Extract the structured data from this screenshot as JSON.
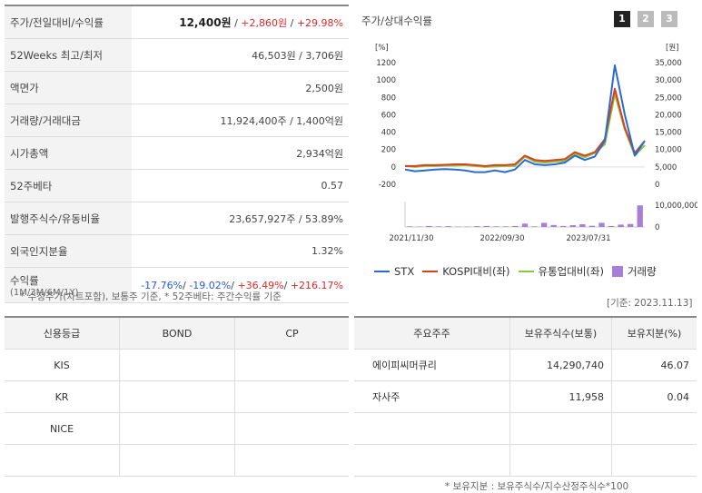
{
  "info": {
    "price_label": "주가/전일대비/수익률",
    "price": "12,400원",
    "change": "+2,860원",
    "change_pct": "+29.98%",
    "rows": [
      {
        "label": "52Weeks 최고/최저",
        "value": "46,503원 / 3,706원"
      },
      {
        "label": "액면가",
        "value": "2,500원"
      },
      {
        "label": "거래량/거래대금",
        "value": "11,924,400주 / 1,400억원"
      },
      {
        "label": "시가총액",
        "value": "2,934억원"
      },
      {
        "label": "52주베타",
        "value": "0.57"
      },
      {
        "label": "발행주식수/유동비율",
        "value": "23,657,927주 / 53.89%"
      },
      {
        "label": "외국인지분율",
        "value": "1.32%"
      }
    ],
    "returns_label": "수익률",
    "returns_sub": "(1M/3M/6M/1Y)",
    "returns": [
      "-17.76%",
      "-19.02%",
      "+36.49%",
      "+216.17%"
    ],
    "note": "* 수정주가(차트포함), 보통주 기준, * 52주베타: 주간수익률 기준"
  },
  "chart_panel": {
    "title": "주가/상대수익률",
    "pages": [
      "1",
      "2",
      "3"
    ],
    "basis": "[기준: 2023.11.13]",
    "colors": {
      "stx": "#2a6ad4",
      "kospi": "#d6421e",
      "industry": "#8cc63e",
      "volume": "#a77fd6"
    }
  },
  "chart_data": {
    "type": "line",
    "left_unit": "[%]",
    "right_unit": "[원]",
    "left_ticks": [
      "1200",
      "1000",
      "800",
      "600",
      "400",
      "200",
      "0",
      "-200"
    ],
    "right_ticks": [
      "35,000",
      "30,000",
      "25,000",
      "20,000",
      "15,000",
      "10,000",
      "5,000",
      "0"
    ],
    "volume_ticks": [
      "10,000,000",
      "0"
    ],
    "x_ticks": [
      "2021/11/30",
      "2022/09/30",
      "2023/07/31"
    ],
    "ylim_left": [
      -200,
      1200
    ],
    "ylim_right": [
      0,
      35000
    ],
    "series": [
      {
        "name": "STX",
        "values": [
          -30,
          -50,
          -40,
          -30,
          -25,
          -30,
          -40,
          -60,
          -60,
          -40,
          -60,
          -30,
          80,
          30,
          20,
          30,
          50,
          130,
          80,
          120,
          300,
          1170,
          600,
          130,
          300
        ]
      },
      {
        "name": "KOSPI대비(좌)",
        "values": [
          10,
          10,
          20,
          20,
          25,
          30,
          30,
          20,
          10,
          20,
          20,
          30,
          130,
          80,
          70,
          80,
          90,
          170,
          130,
          170,
          320,
          900,
          450,
          160,
          300
        ]
      },
      {
        "name": "유통업대비(좌)",
        "values": [
          10,
          0,
          10,
          10,
          15,
          15,
          20,
          10,
          0,
          5,
          10,
          10,
          120,
          60,
          50,
          60,
          70,
          150,
          110,
          160,
          260,
          840,
          430,
          130,
          250
        ]
      }
    ],
    "volume": {
      "name": "거래량",
      "values": [
        0.3,
        0.2,
        0.5,
        0.3,
        0.4,
        0.2,
        0.2,
        0.4,
        0.5,
        0.3,
        0.3,
        0.5,
        1.7,
        0.3,
        2.1,
        1.0,
        0.5,
        0.9,
        1.4,
        0.6,
        2.1,
        0.5,
        1.2,
        1.5,
        10.9
      ]
    }
  },
  "credit": {
    "headers": [
      "신용등급",
      "BOND",
      "CP"
    ],
    "rows": [
      {
        "agency": "KIS",
        "bond": "",
        "cp": ""
      },
      {
        "agency": "KR",
        "bond": "",
        "cp": ""
      },
      {
        "agency": "NICE",
        "bond": "",
        "cp": ""
      },
      {
        "agency": "",
        "bond": "",
        "cp": ""
      }
    ]
  },
  "holders": {
    "headers": [
      "주요주주",
      "보유주식수(보통)",
      "보유지분(%)"
    ],
    "rows": [
      {
        "name": "에이피씨머큐리",
        "shares": "14,290,740",
        "pct": "46.07"
      },
      {
        "name": "자사주",
        "shares": "11,958",
        "pct": "0.04"
      },
      {
        "name": "",
        "shares": "",
        "pct": ""
      },
      {
        "name": "",
        "shares": "",
        "pct": ""
      }
    ],
    "note": "* 보유지분 : 보유주식수/지수산정주식수*100"
  }
}
